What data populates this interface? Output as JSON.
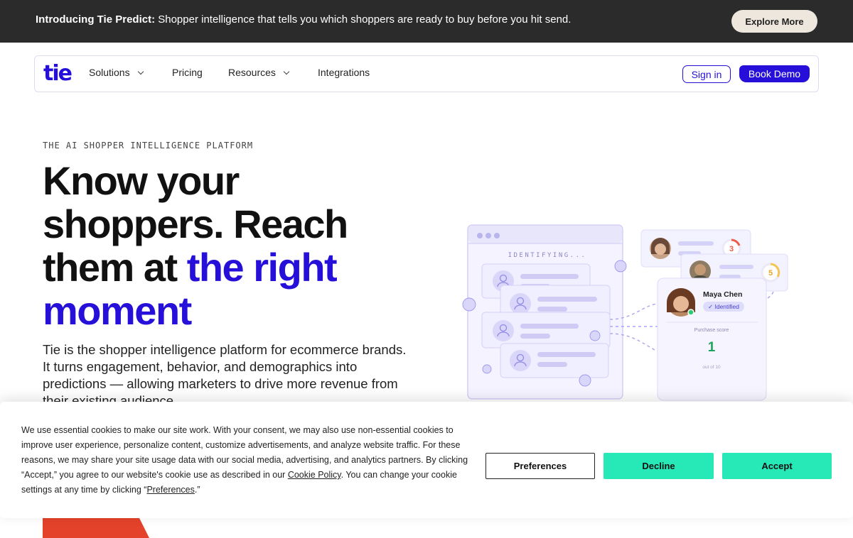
{
  "banner": {
    "intro_bold": "Introducing Tie Predict:",
    "intro_text": " Shopper intelligence that tells you which shoppers are ready to buy before you hit send.",
    "cta_label": "Explore More"
  },
  "nav": {
    "logo": "tie",
    "items": [
      {
        "label": "Solutions",
        "has_dropdown": true
      },
      {
        "label": "Pricing",
        "has_dropdown": false
      },
      {
        "label": "Resources",
        "has_dropdown": true
      },
      {
        "label": "Integrations",
        "has_dropdown": false
      }
    ],
    "signin_label": "Sign in",
    "demo_label": "Book Demo"
  },
  "hero": {
    "eyebrow": "THE AI SHOPPER INTELLIGENCE PLATFORM",
    "headline_plain": "Know your shoppers. Reach them at ",
    "headline_accent": "the right moment",
    "body": "Tie is the shopper intelligence platform for ecommerce brands. It turns engagement, behavior, and demographics into predictions — allowing marketers to drive more revenue from their existing audience."
  },
  "illustration": {
    "panel_label": "IDENTIFYING...",
    "profile_name": "Maya Chen",
    "profile_badge": "✓ Identified",
    "score_label": "Purchase score",
    "score_value": "1",
    "score_scale": "out of 10",
    "mini_score_1": "3",
    "mini_score_2": "5"
  },
  "cookie": {
    "text_before": "We use essential cookies to make our site work. With your consent, we may also use non-essential cookies to improve user experience, personalize content, customize advertisements, and analyze website traffic. For these reasons, we may share your site usage data with our social media, advertising, and analytics partners. By clicking “Accept,” you agree to our website's cookie use as described in our ",
    "policy_link": "Cookie Policy",
    "text_middle": ". You can change your cookie settings at any time by clicking “",
    "prefs_link": "Preferences",
    "text_after": ".”",
    "buttons": {
      "preferences": "Preferences",
      "decline": "Decline",
      "accept": "Accept"
    }
  },
  "colors": {
    "brand": "#2610d9",
    "banner_bg": "#2b2b2b",
    "cookie_accent": "#27e8b7",
    "orange": "#e4422a"
  }
}
